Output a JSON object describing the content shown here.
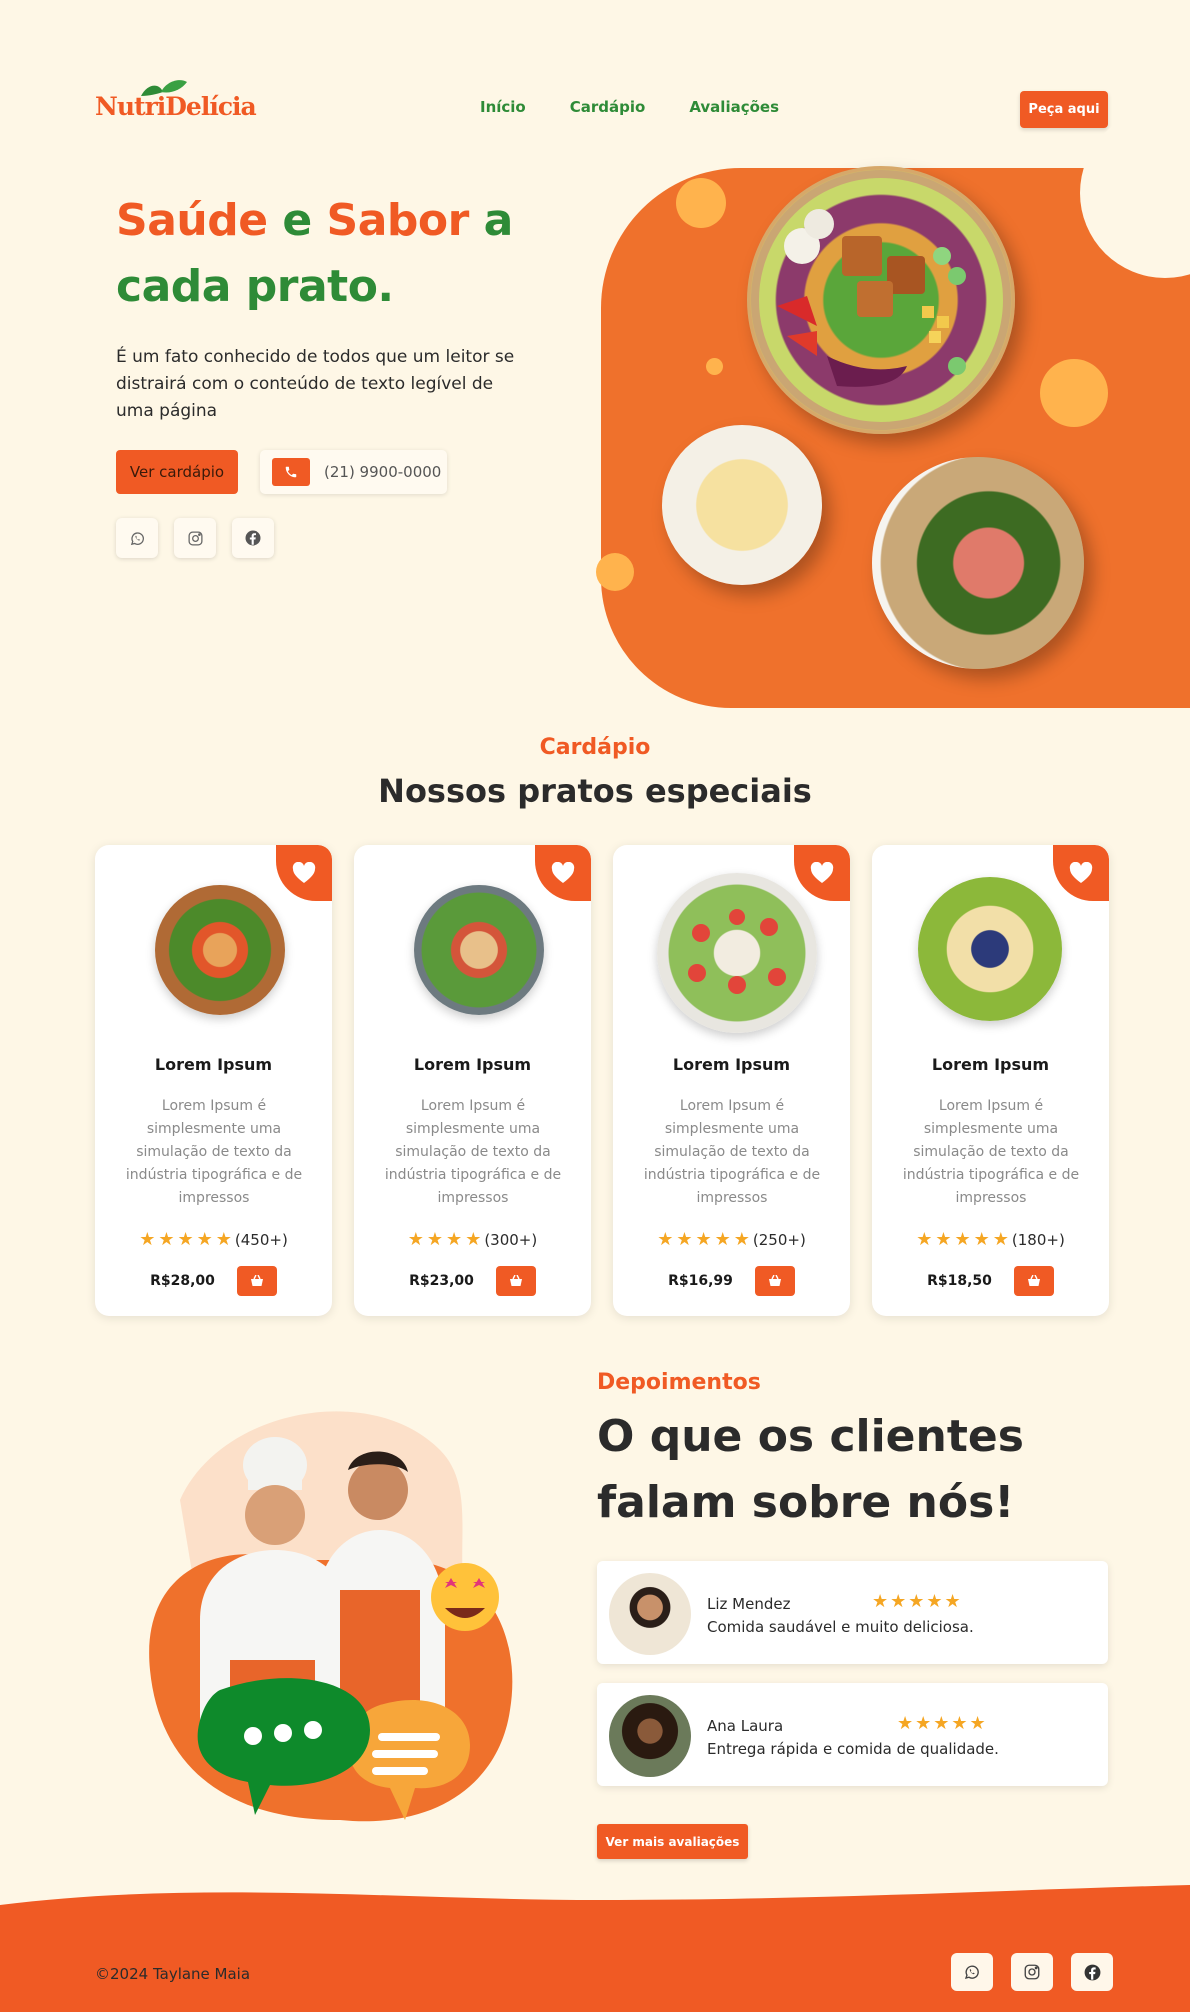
{
  "brand": {
    "name_part1": "Nutri",
    "name_part2": "Delícia"
  },
  "nav": {
    "items": [
      "Início",
      "Cardápio",
      "Avaliações"
    ],
    "order_button": "Peça aqui"
  },
  "hero": {
    "title_orange1": "Saúde",
    "title_green1": " e ",
    "title_orange2": "Sabor",
    "title_green2": " a",
    "title_line2": "cada prato.",
    "description": "É um fato conhecido de todos que um leitor se distrairá com o conteúdo de texto legível de uma página",
    "menu_button": "Ver cardápio",
    "phone": "(21) 9900-0000"
  },
  "menu_section": {
    "kicker": "Cardápio",
    "title": "Nossos pratos especiais",
    "cards": [
      {
        "name": "Lorem Ipsum",
        "desc": "Lorem Ipsum é simplesmente uma simulação de texto da indústria tipográfica e de impressos",
        "rating_count": "(450+)",
        "stars": 5,
        "price": "R$28,00"
      },
      {
        "name": "Lorem Ipsum",
        "desc": "Lorem Ipsum é simplesmente uma simulação de texto da indústria tipográfica e de impressos",
        "rating_count": "(300+)",
        "stars": 4,
        "price": "R$23,00"
      },
      {
        "name": "Lorem Ipsum",
        "desc": "Lorem Ipsum é simplesmente uma simulação de texto da indústria tipográfica e de impressos",
        "rating_count": "(250+)",
        "stars": 5,
        "price": "R$16,99"
      },
      {
        "name": "Lorem Ipsum",
        "desc": "Lorem Ipsum é simplesmente uma simulação de texto da indústria tipográfica e de impressos",
        "rating_count": "(180+)",
        "stars": 5,
        "price": "R$18,50"
      }
    ]
  },
  "testimonials": {
    "kicker": "Depoimentos",
    "title_line1": "O que os clientes",
    "title_line2": "falam sobre nós!",
    "reviews": [
      {
        "name": "Liz Mendez",
        "text": "Comida saudável e muito deliciosa.",
        "stars": 5
      },
      {
        "name": "Ana Laura",
        "text": "Entrega rápida e comida de qualidade.",
        "stars": 5
      }
    ],
    "more_button": "Ver mais avaliações"
  },
  "footer": {
    "copyright": "©2024 Taylane Maia"
  },
  "colors": {
    "accent": "#f05a24",
    "green": "#2e8b37",
    "background": "#fef7e6",
    "star": "#f5a623"
  },
  "icons": [
    "whatsapp-icon",
    "instagram-icon",
    "facebook-icon",
    "phone-icon",
    "heart-icon",
    "basket-icon",
    "star-icon"
  ]
}
